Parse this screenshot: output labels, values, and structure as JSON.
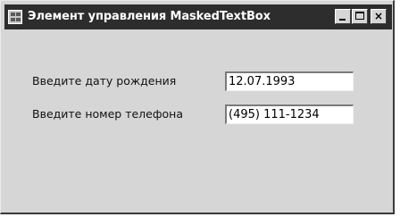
{
  "window": {
    "title": "Элемент управления MaskedTextBox",
    "controls": {
      "minimize": "minimize-icon",
      "maximize": "maximize-icon",
      "close_label": "×"
    }
  },
  "form": {
    "fields": [
      {
        "label": "Введите дату рождения",
        "value": "12.07.1993"
      },
      {
        "label": "Введите номер телефона",
        "value": "(495) 111-1234"
      }
    ]
  },
  "colors": {
    "titlebar": "#2d2d2d",
    "form_background": "#d6d6d6",
    "field_background": "#ffffff"
  }
}
